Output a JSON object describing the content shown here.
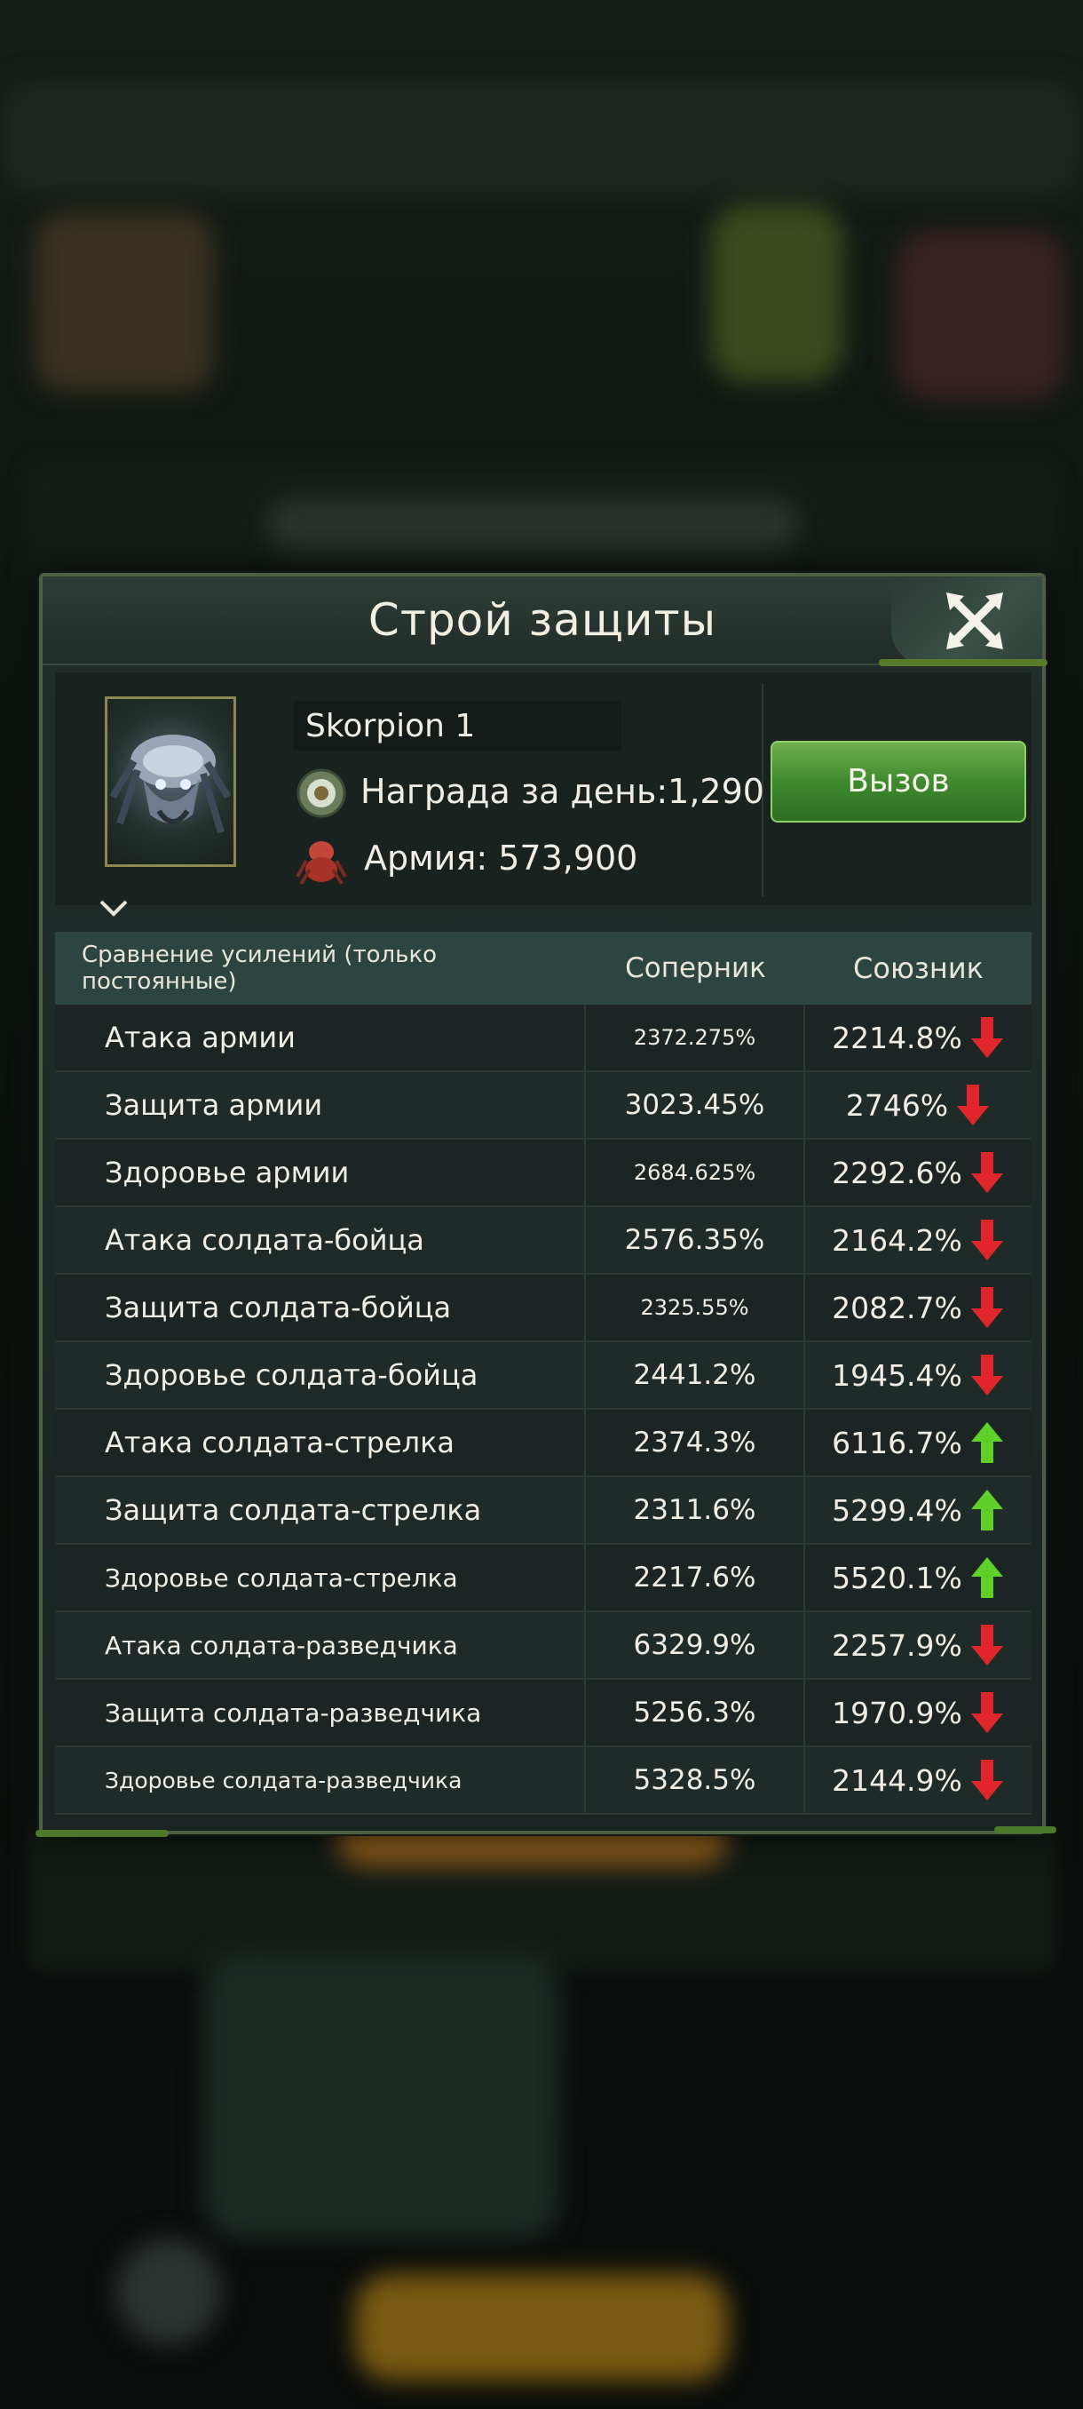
{
  "dialog": {
    "title": "Строй защиты",
    "name": "Skorpion 1",
    "reward": "Награда за день:1,290",
    "army": "Армия: 573,900",
    "challenge_label": "Вызов"
  },
  "table": {
    "headers": [
      "Сравнение усилений (только постоянные)",
      "Соперник",
      "Союзник"
    ],
    "rows": [
      {
        "label": "Атака армии",
        "rival": "2372.275%",
        "ally": "2214.8%",
        "trend": "down"
      },
      {
        "label": "Защита армии",
        "rival": "3023.45%",
        "ally": "2746%",
        "trend": "down"
      },
      {
        "label": "Здоровье армии",
        "rival": "2684.625%",
        "ally": "2292.6%",
        "trend": "down"
      },
      {
        "label": "Атака солдата-бойца",
        "rival": "2576.35%",
        "ally": "2164.2%",
        "trend": "down"
      },
      {
        "label": "Защита солдата-бойца",
        "rival": "2325.55%",
        "ally": "2082.7%",
        "trend": "down"
      },
      {
        "label": "Здоровье солдата-бойца",
        "rival": "2441.2%",
        "ally": "1945.4%",
        "trend": "down"
      },
      {
        "label": "Атака солдата-стрелка",
        "rival": "2374.3%",
        "ally": "6116.7%",
        "trend": "up"
      },
      {
        "label": "Защита солдата-стрелка",
        "rival": "2311.6%",
        "ally": "5299.4%",
        "trend": "up"
      },
      {
        "label": "Здоровье солдата-стрелка",
        "rival": "2217.6%",
        "ally": "5520.1%",
        "trend": "up"
      },
      {
        "label": "Атака солдата-разведчика",
        "rival": "6329.9%",
        "ally": "2257.9%",
        "trend": "down"
      },
      {
        "label": "Защита солдата-разведчика",
        "rival": "5256.3%",
        "ally": "1970.9%",
        "trend": "down"
      },
      {
        "label": "Здоровье солдата-разведчика",
        "rival": "5328.5%",
        "ally": "2144.9%",
        "trend": "down"
      }
    ]
  },
  "colors": {
    "up": "#5fcf2a",
    "down": "#e0262a",
    "accent": "#4c8a32"
  }
}
